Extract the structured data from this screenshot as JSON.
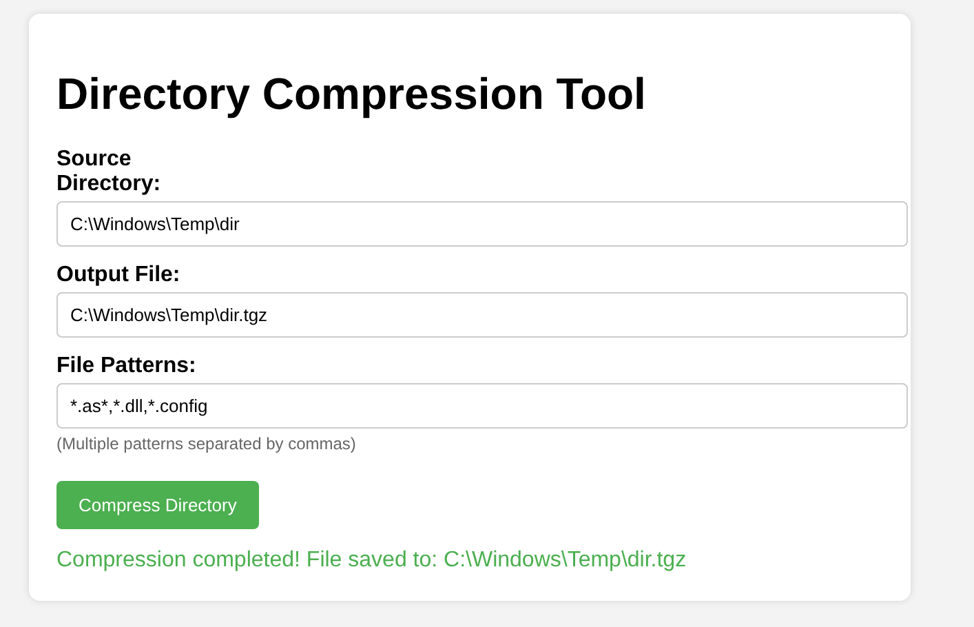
{
  "title": "Directory Compression Tool",
  "fields": [
    {
      "label": "Source Directory:",
      "value": "C:\\Windows\\Temp\\dir"
    },
    {
      "label": "Output File:",
      "value": "C:\\Windows\\Temp\\dir.tgz"
    },
    {
      "label": "File Patterns:",
      "value": "*.as*,*.dll,*.config",
      "hint": "(Multiple patterns separated by commas)"
    }
  ],
  "button": "Compress Directory",
  "status": {
    "kind": "success",
    "text": "Compression completed! File saved to: C:\\Windows\\Temp\\dir.tgz"
  }
}
